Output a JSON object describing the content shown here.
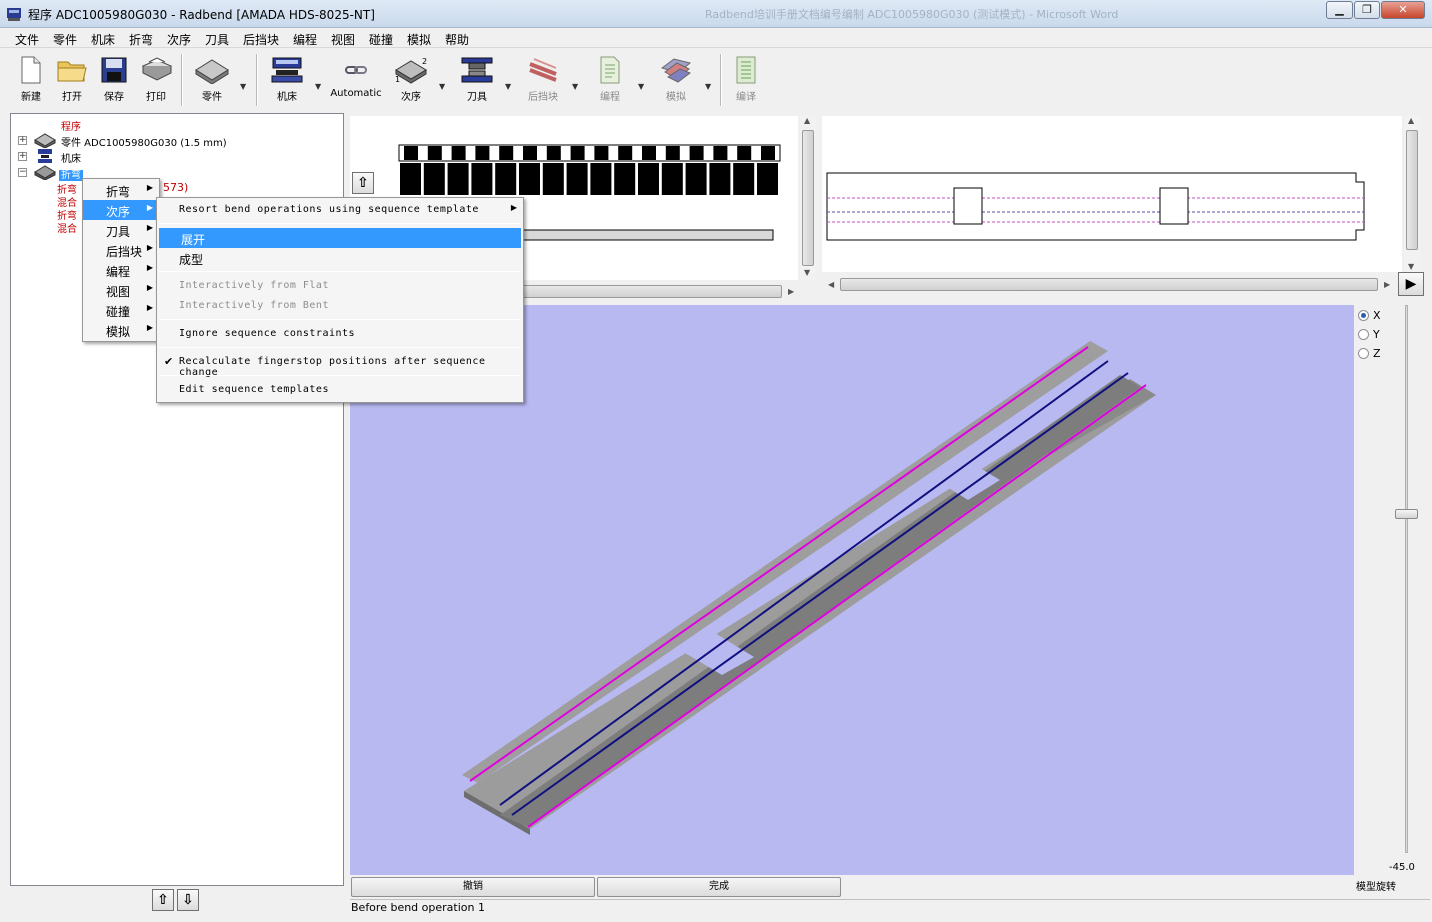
{
  "window": {
    "title": "程序 ADC1005980G030 - Radbend [AMADA HDS-8025-NT]",
    "background_title": "Radbend培训手册文档编号编制 ADC1005980G030 (测试模式) - Microsoft Word",
    "minimize": "▁",
    "restore": "❐",
    "close": "✕"
  },
  "menubar": [
    "文件",
    "零件",
    "机床",
    "折弯",
    "次序",
    "刀具",
    "后挡块",
    "编程",
    "视图",
    "碰撞",
    "模拟",
    "帮助"
  ],
  "toolbar": {
    "new": "新建",
    "open": "打开",
    "save": "保存",
    "print": "打印",
    "part": "零件",
    "machine": "机床",
    "automatic": "Automatic",
    "sequence": "次序",
    "tooling": "刀具",
    "backgauge": "后挡块",
    "program": "编程",
    "simulate": "模拟",
    "compile": "编译",
    "dropdown": "▼"
  },
  "tree": {
    "root": "程序",
    "part": "零件 ADC1005980G030 (1.5 mm)",
    "machine": "机床",
    "bend": "折弯",
    "children": [
      {
        "label": "折弯",
        "suffix": "573)"
      },
      {
        "label": "混合",
        "suffix": ""
      },
      {
        "label": "折弯",
        "suffix": ""
      },
      {
        "label": "混合",
        "suffix": ""
      }
    ],
    "expand_plus": "+",
    "expand_minus": "−",
    "up": "⇧",
    "down": "⇩"
  },
  "context_menu": {
    "items": [
      {
        "label": "折弯",
        "arrow": "▶"
      },
      {
        "label": "次序",
        "arrow": "▶"
      },
      {
        "label": "刀具",
        "arrow": "▶"
      },
      {
        "label": "后挡块",
        "arrow": "▶"
      },
      {
        "label": "编程",
        "arrow": "▶"
      },
      {
        "label": "视图",
        "arrow": "▶"
      },
      {
        "label": "碰撞",
        "arrow": "▶"
      },
      {
        "label": "模拟",
        "arrow": "▶"
      }
    ]
  },
  "sequence_submenu": {
    "resort": "Resort bend operations using sequence template",
    "unfold": "展开",
    "form": "成型",
    "from_flat": "Interactively from Flat",
    "from_bent": "Interactively from Bent",
    "ignore": "Ignore sequence constraints",
    "recalc": "Recalculate fingerstop positions after sequence change",
    "check": "✔",
    "edit": "Edit sequence templates",
    "arrow": "▶"
  },
  "viewport": {
    "axes": [
      "X",
      "Y",
      "Z"
    ],
    "selected_axis": "X",
    "slider_value": "-45.0",
    "slider_label": "模型旋转",
    "play": "▶",
    "up_arrow": "⇧"
  },
  "buttons": {
    "undo": "撤销",
    "done": "完成"
  },
  "status": "Before bend operation 1"
}
